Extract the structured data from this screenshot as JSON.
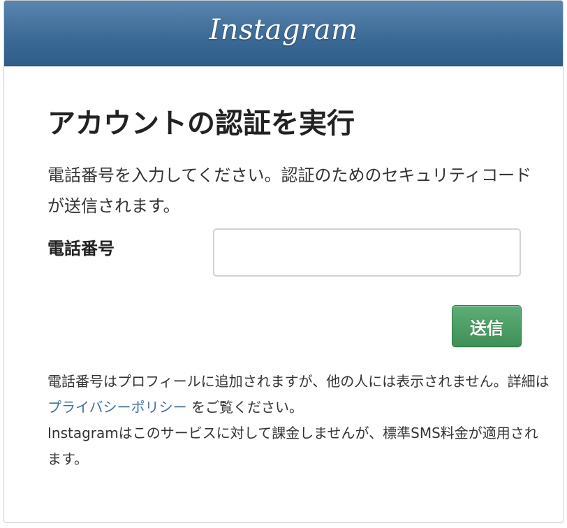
{
  "header": {
    "logo_text": "Instagram",
    "background_color": "#3d6b97"
  },
  "main": {
    "title": "アカウントの認証を実行",
    "description": "電話番号を入力してください。認証のためのセキュリティコードが送信されます。",
    "phone_field": {
      "label": "電話番号",
      "value": "",
      "placeholder": ""
    },
    "send_button": {
      "label": "送信",
      "color": "#4a9b63"
    },
    "footnote": {
      "part1": "電話番号はプロフィールに追加されますが、他の人には表示されません。詳細は ",
      "privacy_link": "プライバシーポリシー",
      "part2": " をご覧ください。",
      "sms_notice": "Instagramはこのサービスに対して課金しませんが、標準SMS料金が適用されます。",
      "link_color": "#3f72a6"
    }
  }
}
